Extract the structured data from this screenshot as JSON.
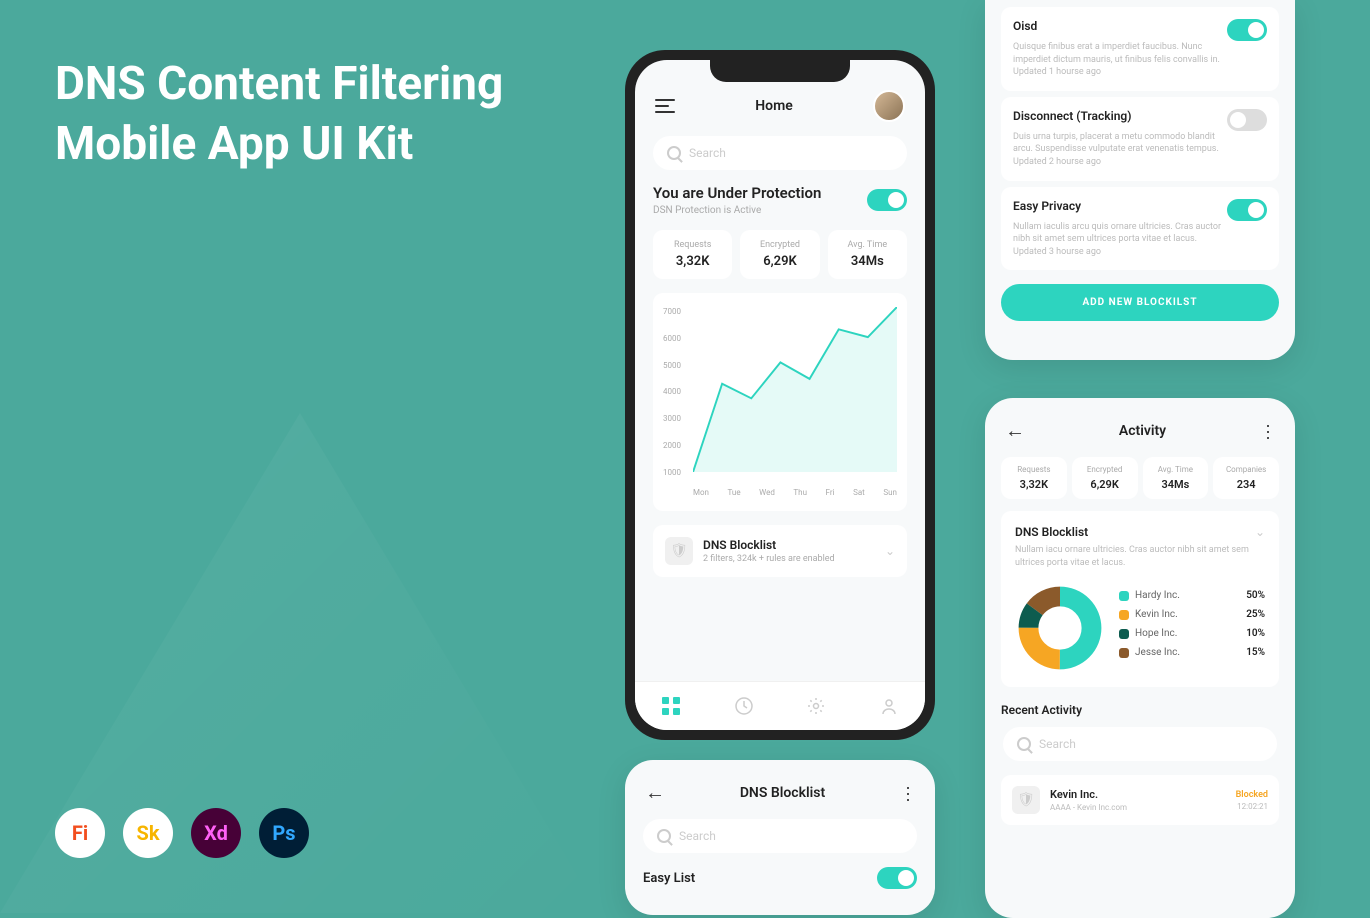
{
  "title_line1": "DNS Content Filtering",
  "title_line2": "Mobile App UI Kit",
  "tools": [
    "Fi",
    "Sk",
    "Xd",
    "Ps"
  ],
  "home": {
    "header": "Home",
    "search_ph": "Search",
    "protection_title": "You are Under Protection",
    "protection_sub": "DSN Protection is Active",
    "stats": [
      {
        "label": "Requests",
        "value": "3,32K"
      },
      {
        "label": "Encrypted",
        "value": "6,29K"
      },
      {
        "label": "Avg. Time",
        "value": "34Ms"
      }
    ],
    "blocklist_title": "DNS Blocklist",
    "blocklist_sub": "2 filters, 324k + rules are enabled"
  },
  "chart_data": {
    "type": "line",
    "x": [
      "Mon",
      "Tue",
      "Wed",
      "Thu",
      "Fri",
      "Sat",
      "Sun"
    ],
    "y_ticks": [
      1000,
      2000,
      3000,
      4000,
      5000,
      6000,
      7000
    ],
    "values": [
      1000,
      4200,
      3700,
      5000,
      4400,
      6200,
      5900,
      7000
    ],
    "ylim": [
      1000,
      7000
    ]
  },
  "blocklists": {
    "header": "DNS Blocklist",
    "search_ph": "Search",
    "easy_list": "Easy List",
    "items": [
      {
        "title": "Oisd",
        "desc": "Quisque finibus erat a imperdiet faucibus. Nunc imperdiet dictum mauris, ut finibus felis convallis in. Updated 1 hourse ago",
        "on": true
      },
      {
        "title": "Disconnect (Tracking)",
        "desc": "Duis urna turpis, placerat a metu commodo blandit arcu. Suspendisse vulputate erat venenatis tempus. Updated 2 hourse ago",
        "on": false
      },
      {
        "title": "Easy Privacy",
        "desc": "Nullam iaculis arcu quis ornare ultricies. Cras auctor nibh sit amet sem ultrices porta vitae et lacus. Updated 3 hourse ago",
        "on": true
      }
    ],
    "add_btn": "ADD NEW BLOCKILST"
  },
  "activity": {
    "header": "Activity",
    "stats": [
      {
        "label": "Requests",
        "value": "3,32K"
      },
      {
        "label": "Encrypted",
        "value": "6,29K"
      },
      {
        "label": "Avg. Time",
        "value": "34Ms"
      },
      {
        "label": "Companies",
        "value": "234"
      }
    ],
    "dns_title": "DNS Blocklist",
    "dns_desc": "Nullam iacu ornare ultricies. Cras auctor nibh sit amet sem ultrices porta vitae et lacus.",
    "donut": [
      {
        "name": "Hardy Inc.",
        "value": "50%",
        "color": "#2dd4bf"
      },
      {
        "name": "Kevin Inc.",
        "value": "25%",
        "color": "#f6a623"
      },
      {
        "name": "Hope Inc.",
        "value": "10%",
        "color": "#0d5c4f"
      },
      {
        "name": "Jesse Inc.",
        "value": "15%",
        "color": "#8b5a2b"
      }
    ],
    "recent_title": "Recent Activity",
    "search_ph": "Search",
    "recent": [
      {
        "title": "Kevin Inc.",
        "sub": "AAAA - Kevin Inc.com",
        "status": "Blocked",
        "time": "12:02:21"
      }
    ]
  }
}
